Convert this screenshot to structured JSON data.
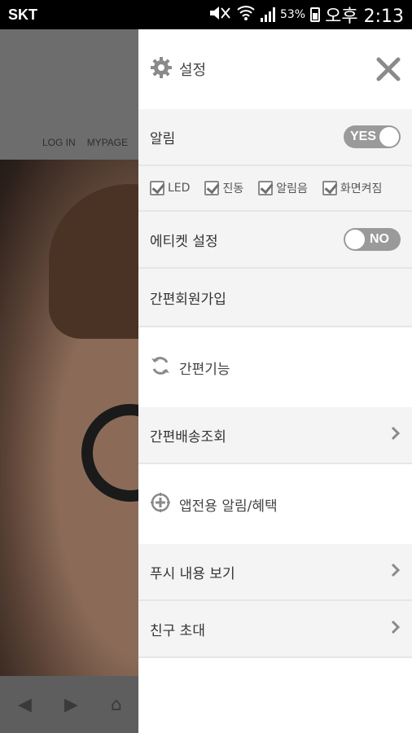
{
  "status_bar": {
    "carrier": "SKT",
    "battery": "53%",
    "time": "오후 2:13"
  },
  "background_app": {
    "nav": [
      "LOG IN",
      "MYPAGE"
    ]
  },
  "drawer": {
    "title": "설정",
    "notification": {
      "label": "알림",
      "toggle": "YES"
    },
    "options": [
      "LED",
      "진동",
      "알림음",
      "화면켜짐"
    ],
    "etiquette": {
      "label": "에티켓 설정",
      "toggle": "NO"
    },
    "easy_signup": "간편회원가입",
    "easy_features": "간편기능",
    "easy_delivery": "간편배송조회",
    "app_exclusive": "앱전용 알림/혜택",
    "push_view": "푸시 내용 보기",
    "invite_friends": "친구 초대"
  }
}
